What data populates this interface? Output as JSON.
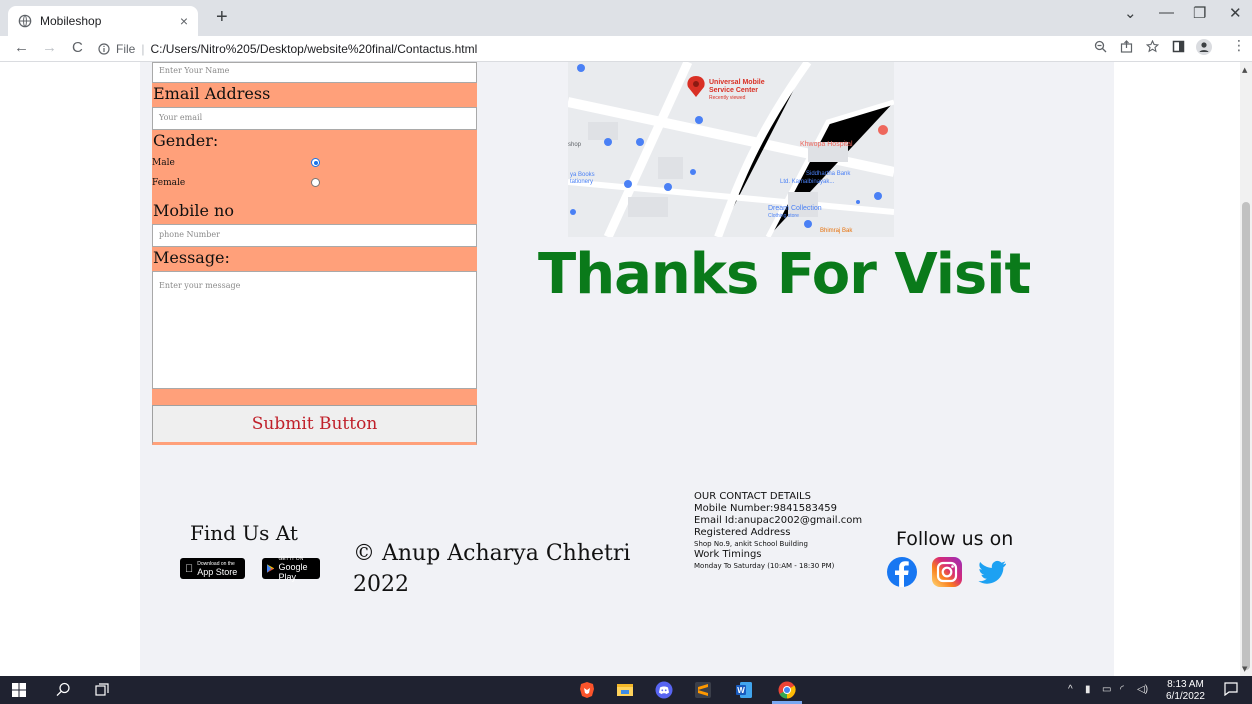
{
  "browser": {
    "tab_title": "Mobileshop",
    "tab_close": "×",
    "new_tab": "+",
    "window": {
      "minimize": "—",
      "restore": "❐",
      "close": "✕",
      "dropdown": "⌄"
    },
    "nav": {
      "back": "←",
      "forward": "→",
      "reload": "C"
    },
    "url_scheme": "File",
    "url_path": "C:/Users/Nitro%205/Desktop/website%20final/Contactus.html"
  },
  "form": {
    "name_placeholder": "Enter Your Name",
    "email_label": "Email Address",
    "email_placeholder": "Your email",
    "gender_label": "Gender:",
    "gender_options": [
      "Male",
      "Female"
    ],
    "gender_selected": "Male",
    "mobile_label": "Mobile no",
    "mobile_placeholder": "phone Number",
    "message_label": "Message:",
    "message_placeholder": "Enter your message",
    "submit_label": "Submit Button"
  },
  "map": {
    "places": [
      "Universal Mobile",
      "Service Center",
      "Recently viewed",
      "Khwopa Hospital",
      "ya Books",
      "tationery",
      "Siddhartha Bank",
      "Ltd. Kamalbinayak...",
      "Dream Collection",
      "Clothing store",
      "Bhimraj Bak",
      "shop"
    ]
  },
  "thanks_text": "Thanks For Visit",
  "footer": {
    "find_us": "Find Us At",
    "app_store_small": "Download on the",
    "app_store_big": "App Store",
    "google_play_small": "GET IT ON",
    "google_play_big": "Google Play",
    "copyright_line1": "© Anup Acharya Chhetri",
    "copyright_line2": "2022",
    "contact_heading": "OUR CONTACT DETAILS",
    "mobile": "Mobile Number:9841583459",
    "email": "Email Id:anupac2002@gmail.com",
    "address_heading": "Registered Address",
    "address": "Shop No.9, ankit School Building",
    "timings_heading": "Work Timings",
    "timings": "Monday To Saturday (10:AM - 18:30 PM)",
    "follow_us": "Follow us on",
    "social_icons": [
      "facebook-icon",
      "instagram-icon",
      "twitter-icon"
    ]
  },
  "taskbar": {
    "time": "8:13 AM",
    "date": "6/1/2022"
  },
  "colors": {
    "form_bg": "#ffa07a",
    "thanks": "#0a7a1a",
    "submit_text": "#c0202a",
    "page_bg": "#f1f2f6"
  }
}
